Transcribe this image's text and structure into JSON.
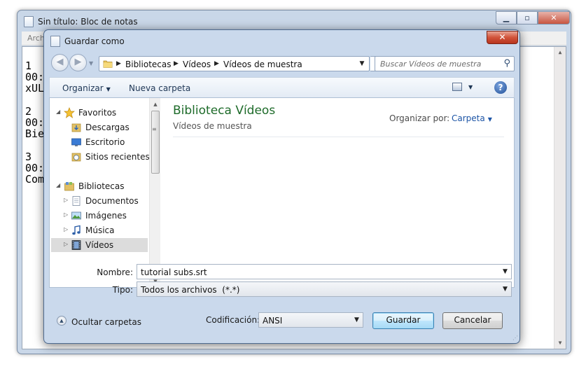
{
  "notepad": {
    "title": "Sin título: Bloc de notas",
    "menu_first": "Arch",
    "lines": [
      "1",
      "00:",
      "xUL",
      "",
      "2",
      "00:",
      "Bie",
      "",
      "3",
      "00:",
      "Com"
    ]
  },
  "dialog": {
    "title": "Guardar como",
    "close_glyph": "✕",
    "address": {
      "crumbs": [
        "Bibliotecas",
        "Vídeos",
        "Vídeos de muestra"
      ]
    },
    "search_placeholder": "Buscar Vídeos de muestra",
    "toolbar": {
      "organize_label": "Organizar",
      "new_folder_label": "Nueva carpeta",
      "help_glyph": "?"
    },
    "nav": {
      "favorites_label": "Favoritos",
      "favorites": [
        "Descargas",
        "Escritorio",
        "Sitios recientes"
      ],
      "libraries_label": "Bibliotecas",
      "libraries": [
        "Documentos",
        "Imágenes",
        "Música",
        "Vídeos"
      ]
    },
    "content": {
      "title": "Biblioteca Vídeos",
      "subtitle": "Vídeos de muestra",
      "arrange_label": "Organizar por:",
      "arrange_value": "Carpeta"
    },
    "fields": {
      "name_label": "Nombre:",
      "name_value": "tutorial subs.srt",
      "type_label": "Tipo:",
      "type_value": "Todos los archivos  (*.*)"
    },
    "footer": {
      "hide_folders_label": "Ocultar carpetas",
      "encoding_label": "Codificación:",
      "encoding_value": "ANSI",
      "save_label": "Guardar",
      "cancel_label": "Cancelar"
    }
  },
  "colors": {
    "library_title": "#1e6b2a",
    "link_blue": "#1d55a6",
    "dialog_frame": "#cad9ec"
  }
}
